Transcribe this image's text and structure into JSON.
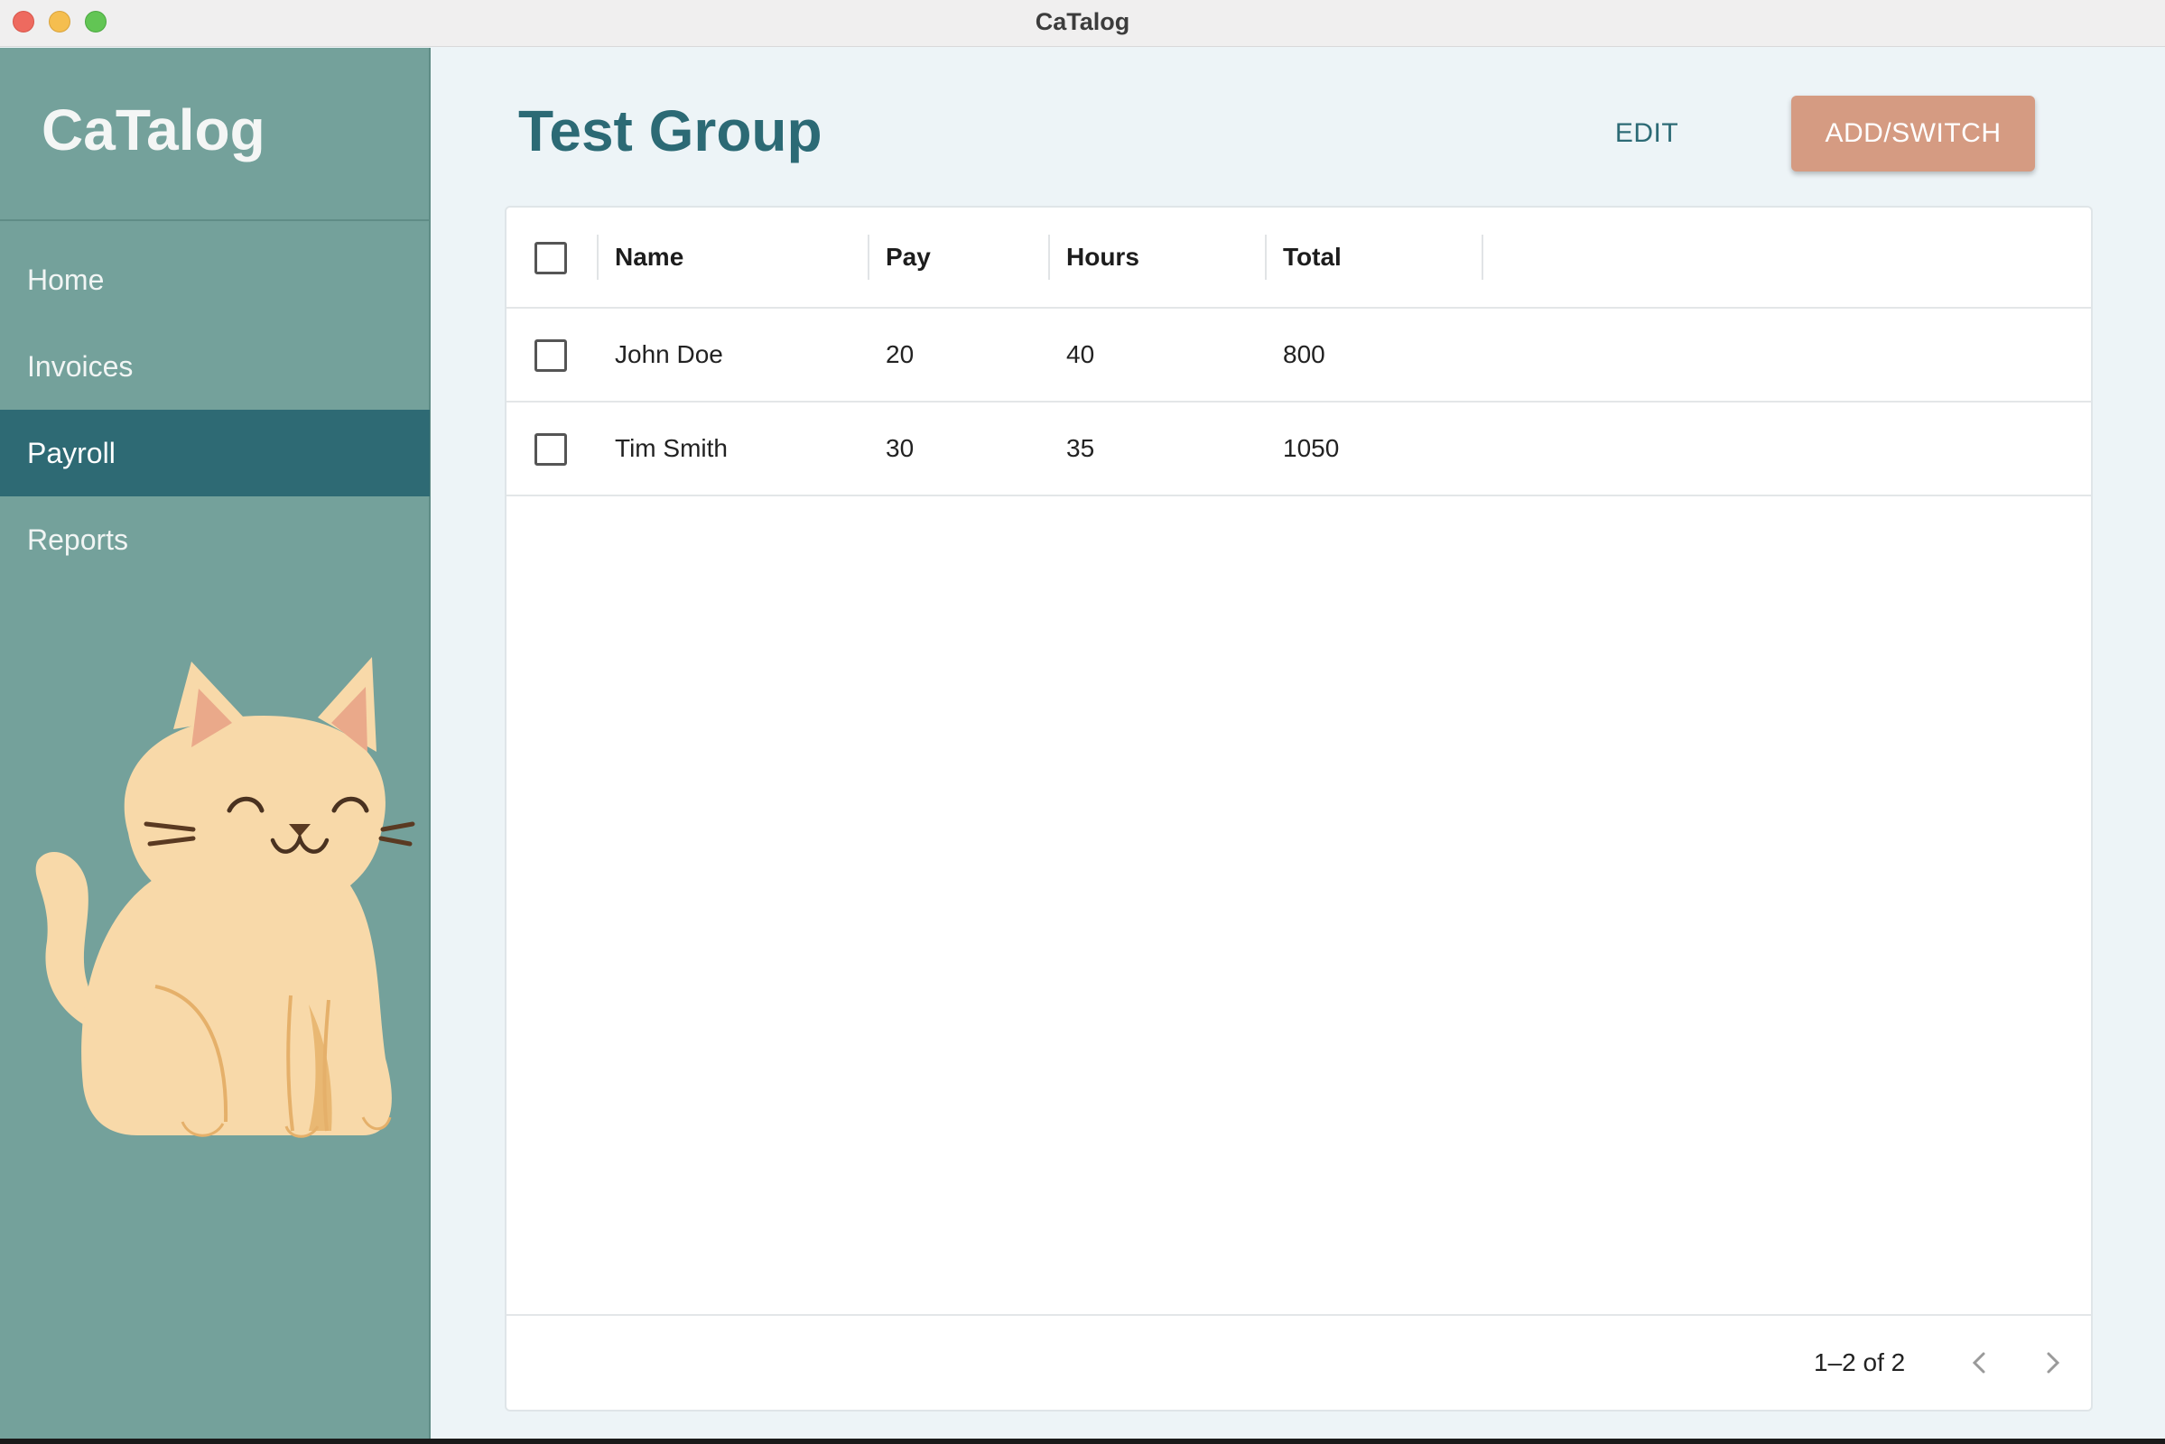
{
  "window": {
    "title": "CaTalog"
  },
  "sidebar": {
    "brand": "CaTalog",
    "items": [
      {
        "label": "Home",
        "active": false
      },
      {
        "label": "Invoices",
        "active": false
      },
      {
        "label": "Payroll",
        "active": true
      },
      {
        "label": "Reports",
        "active": false
      }
    ],
    "illustration": "sitting-cat-icon"
  },
  "main": {
    "title": "Test Group",
    "edit_label": "EDIT",
    "add_label": "ADD/SWITCH"
  },
  "table": {
    "columns": [
      "Name",
      "Pay",
      "Hours",
      "Total"
    ],
    "rows": [
      {
        "name": "John Doe",
        "pay": "20",
        "hours": "40",
        "total": "800"
      },
      {
        "name": "Tim Smith",
        "pay": "30",
        "hours": "35",
        "total": "1050"
      }
    ],
    "pagination": "1–2 of 2"
  },
  "colors": {
    "sidebar": "#74a19b",
    "sidebar_active": "#2e6a74",
    "accent_button": "#d59b82",
    "title": "#2c6a75"
  }
}
